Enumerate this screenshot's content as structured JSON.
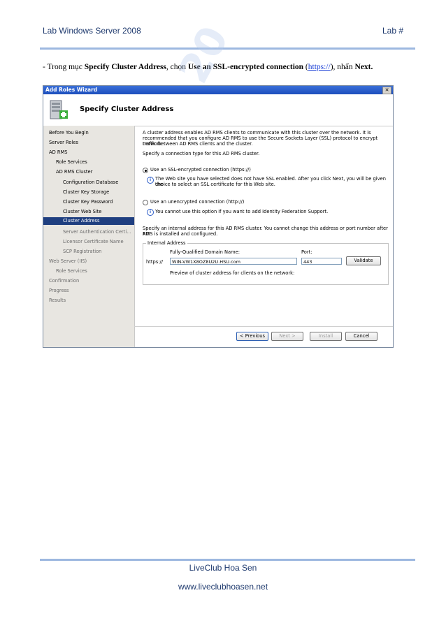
{
  "header": {
    "left": "Lab Windows Server 2008",
    "right": "Lab #"
  },
  "instruction": {
    "prefix": "- Trong mục ",
    "b1": "Specify Cluster Address",
    "mid1": ", chọn ",
    "b2": "Use an SSL-encrypted connection",
    "open_paren": " (",
    "link": "https://",
    "close": "), nhấn ",
    "b3": "Next."
  },
  "dialog": {
    "title": "Add Roles Wizard",
    "close_glyph": "✕",
    "heading": "Specify Cluster Address",
    "nav": [
      {
        "label": "Before You Begin",
        "state": "normal"
      },
      {
        "label": "Server Roles",
        "state": "normal"
      },
      {
        "label": "AD RMS",
        "state": "normal"
      },
      {
        "label": "Role Services",
        "state": "normal"
      },
      {
        "label": "AD RMS Cluster",
        "state": "normal"
      },
      {
        "label": "Configuration Database",
        "state": "normal"
      },
      {
        "label": "Cluster Key Storage",
        "state": "normal"
      },
      {
        "label": "Cluster Key Password",
        "state": "normal"
      },
      {
        "label": "Cluster Web Site",
        "state": "normal"
      },
      {
        "label": "Cluster Address",
        "state": "selected"
      },
      {
        "label": "Server Authentication Certi...",
        "state": "dim"
      },
      {
        "label": "Licensor Certificate Name",
        "state": "dim"
      },
      {
        "label": "SCP Registration",
        "state": "dim"
      },
      {
        "label": "Web Server (IIS)",
        "state": "dim"
      },
      {
        "label": "Role Services",
        "state": "dim"
      },
      {
        "label": "Confirmation",
        "state": "dim"
      },
      {
        "label": "Progress",
        "state": "dim"
      },
      {
        "label": "Results",
        "state": "dim"
      }
    ],
    "intro_1": "A cluster address enables AD RMS clients to communicate with this cluster over the network. It is",
    "intro_2": "recommended that you configure AD RMS to use the Secure Sockets Layer (SSL) protocol to encrypt network",
    "intro_3": "traffic between AD RMS clients and the cluster.",
    "specify_type": "Specify a connection type for this AD RMS cluster.",
    "ssl_option": "Use an SSL-encrypted connection (https://)",
    "ssl_info_1": "The Web site you have selected does not have SSL enabled. After you click Next, you will be given the",
    "ssl_info_2": "choice to select an SSL certificate for this Web site.",
    "unenc_option": "Use an unencrypted connection (http://)",
    "unenc_info": "You cannot use this option if you want to add Identity Federation Support.",
    "internal_text_1": "Specify an internal address for this AD RMS cluster. You cannot change this address or port number after AD",
    "internal_text_2": "RMS is installed and configured.",
    "group_label": "Internal Address",
    "fqdn_label": "Fully-Qualified Domain Name:",
    "port_label": "Port:",
    "protocol": "https://",
    "fqdn_value": "WIN-VW1X8OZ8U2U.HSU.com",
    "port_value": "443",
    "validate_button": "Validate",
    "preview_label": "Preview of cluster address for clients on the network:",
    "buttons": {
      "previous": "< Previous",
      "next": "Next >",
      "install": "Install",
      "cancel": "Cancel"
    }
  },
  "watermark": "Copyright© 20",
  "footer": {
    "line1": "LiveClub Hoa Sen",
    "line2": "www.liveclubhoasen.net"
  }
}
